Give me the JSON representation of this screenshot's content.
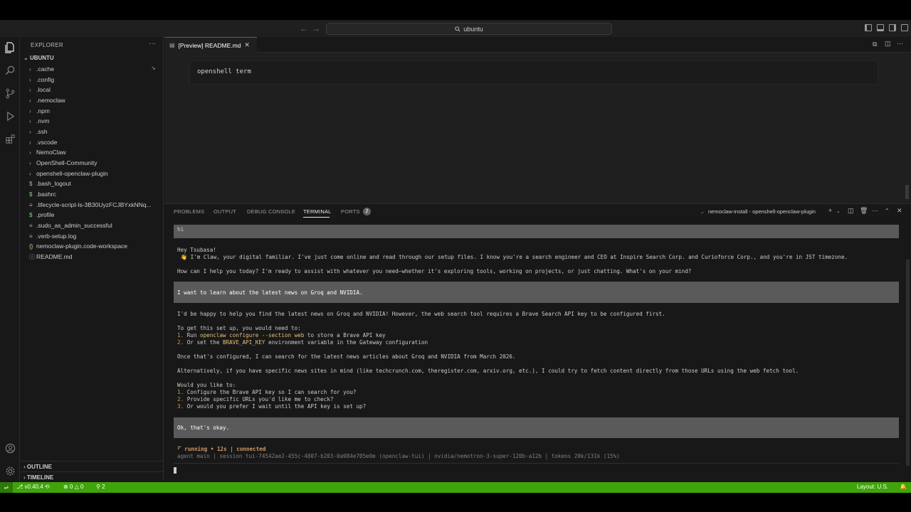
{
  "titlebar": {
    "search_text": "ubuntu",
    "search_icon": "search-icon"
  },
  "sidebar": {
    "title": "EXPLORER",
    "more": "···",
    "root": "UBUNTU",
    "items": [
      {
        "label": ".cache",
        "kind": "folder"
      },
      {
        "label": ".config",
        "kind": "folder"
      },
      {
        "label": ".local",
        "kind": "folder"
      },
      {
        "label": ".nemoclaw",
        "kind": "folder"
      },
      {
        "label": ".npm",
        "kind": "folder"
      },
      {
        "label": ".nvm",
        "kind": "folder"
      },
      {
        "label": ".ssh",
        "kind": "folder"
      },
      {
        "label": ".vscode",
        "kind": "folder"
      },
      {
        "label": "NemoClaw",
        "kind": "folder"
      },
      {
        "label": "OpenShell-Community",
        "kind": "folder"
      },
      {
        "label": "openshell-openclaw-plugin",
        "kind": "folder"
      },
      {
        "label": ".bash_logout",
        "kind": "shell"
      },
      {
        "label": ".bashrc",
        "kind": "shell"
      },
      {
        "label": ".lifecycle-script-ls-3B30UyzFCJBYxkNNq...",
        "kind": "file"
      },
      {
        "label": ".profile",
        "kind": "shell"
      },
      {
        "label": ".sudo_as_admin_successful",
        "kind": "file"
      },
      {
        "label": ".verb-setup.log",
        "kind": "file"
      },
      {
        "label": "nemoclaw-plugin.code-workspace",
        "kind": "json"
      },
      {
        "label": "README.md",
        "kind": "info"
      }
    ],
    "outline": "OUTLINE",
    "timeline": "TIMELINE"
  },
  "editor": {
    "tab_label": "[Preview] README.md",
    "code": "openshell term"
  },
  "panel": {
    "tabs": [
      "PROBLEMS",
      "OUTPUT",
      "DEBUG CONSOLE",
      "TERMINAL",
      "PORTS"
    ],
    "ports_count": "2",
    "terminal_name": "nemoclaw-install - openshell-openclaw-plugin"
  },
  "terminal": {
    "user1": "hi",
    "greet1": "Hey Tsubasa!",
    "greet2": " 👋 I'm Claw, your digital familiar. I've just come online and read through our setup files. I know you're a search engineer and CEO at Inspire Search Corp. and Curioforce Corp., and you're in JST timezone.",
    "greet3": "How can I help you today? I'm ready to assist with whatever you need—whether it's exploring tools, working on projects, or just chatting. What's on your mind?",
    "user2": "I want to learn about the latest news on Groq and NVIDIA.",
    "reply1": "I'd be happy to help you find the latest news on Groq and NVIDIA! However, the web search tool requires a Brave Search API key to be configured first.",
    "reply2": "To get this set up, you would need to:",
    "step1_num": "1.",
    "step1_a": " Run ",
    "step1_cmd": "openclaw configure --section web",
    "step1_b": " to store a Brave API key",
    "step2_num": "2.",
    "step2_a": " Or set the ",
    "step2_var": "BRAVE_API_KEY",
    "step2_b": " environment variable in the Gateway configuration",
    "reply3": "Once that's configured, I can search for the latest news articles about Groq and NVIDIA from March 2026.",
    "reply4": "Alternatively, if you have specific news sites in mind (like techcrunch.com, theregister.com, arxiv.org, etc.), I could try to fetch content directly from those URLs using the web fetch tool.",
    "reply5": "Would you like to:",
    "opt1_num": "1.",
    "opt1": " Configure the Brave API key so I can search for you?",
    "opt2_num": "2.",
    "opt2": " Provide specific URLs you'd like me to check?",
    "opt3_num": "3.",
    "opt3": " Or would you prefer I wait until the API key is set up?",
    "user3": "Ok, that's okay.",
    "spinner": "⠋",
    "status": " running • 12s | connected",
    "info": "agent main | session tui-74542ae2-455c-4807-b203-0a984e705e0e (openclaw-tui) | nvidia/nemotron-3-super-120b-a12b | tokens 20k/131k (15%)"
  },
  "statusbar": {
    "version": "v0.40.4",
    "errors": "0",
    "warnings": "0",
    "ports": "2",
    "layout": "Layout: U.S."
  },
  "colors": {
    "accent": "#0078d4",
    "status": "#3fa40a",
    "highlight": "#5a5a5a"
  }
}
